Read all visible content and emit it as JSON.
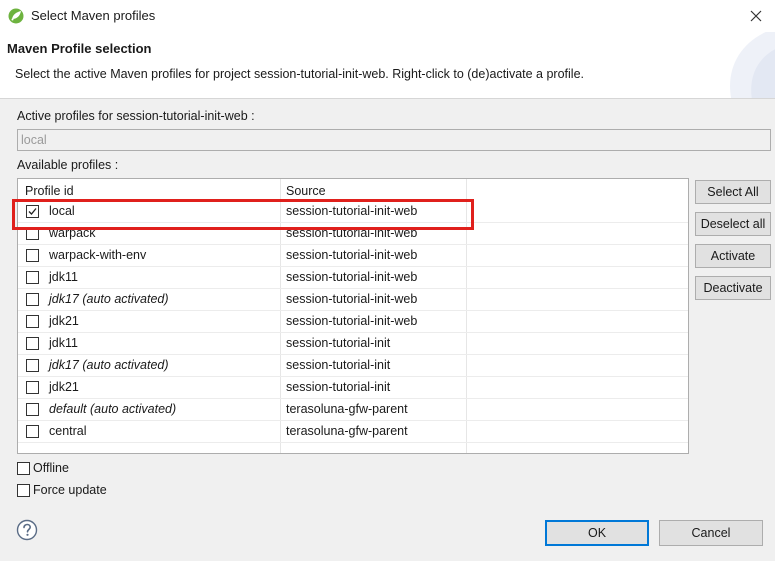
{
  "window": {
    "title": "Select Maven profiles",
    "app_icon": "eclipse-spring-icon",
    "close_icon": "close-icon"
  },
  "header": {
    "title": "Maven Profile selection",
    "message": "Select the active Maven profiles for project session-tutorial-init-web. Right-click to (de)activate a profile."
  },
  "active_profiles": {
    "label": "Active profiles for session-tutorial-init-web :",
    "value": "local"
  },
  "available_profiles": {
    "label": "Available profiles :",
    "columns": [
      "Profile id",
      "Source"
    ],
    "rows": [
      {
        "id": "local",
        "source": "session-tutorial-init-web",
        "checked": true,
        "italic": false
      },
      {
        "id": "warpack",
        "source": "session-tutorial-init-web",
        "checked": false,
        "italic": false
      },
      {
        "id": "warpack-with-env",
        "source": "session-tutorial-init-web",
        "checked": false,
        "italic": false
      },
      {
        "id": "jdk11",
        "source": "session-tutorial-init-web",
        "checked": false,
        "italic": false
      },
      {
        "id": "jdk17 (auto activated)",
        "source": "session-tutorial-init-web",
        "checked": false,
        "italic": true
      },
      {
        "id": "jdk21",
        "source": "session-tutorial-init-web",
        "checked": false,
        "italic": false
      },
      {
        "id": "jdk11",
        "source": "session-tutorial-init",
        "checked": false,
        "italic": false
      },
      {
        "id": "jdk17 (auto activated)",
        "source": "session-tutorial-init",
        "checked": false,
        "italic": true
      },
      {
        "id": "jdk21",
        "source": "session-tutorial-init",
        "checked": false,
        "italic": false
      },
      {
        "id": "default (auto activated)",
        "source": "terasoluna-gfw-parent",
        "checked": false,
        "italic": true
      },
      {
        "id": "central",
        "source": "terasoluna-gfw-parent",
        "checked": false,
        "italic": false
      }
    ]
  },
  "side_buttons": {
    "select_all": "Select All",
    "deselect_all": "Deselect all",
    "activate": "Activate",
    "deactivate": "Deactivate"
  },
  "options": {
    "offline": "Offline",
    "force_update": "Force update"
  },
  "footer": {
    "help_icon": "help-icon",
    "ok": "OK",
    "cancel": "Cancel"
  },
  "colors": {
    "highlight": "#e0201c",
    "default_button_border": "#0078d7"
  }
}
